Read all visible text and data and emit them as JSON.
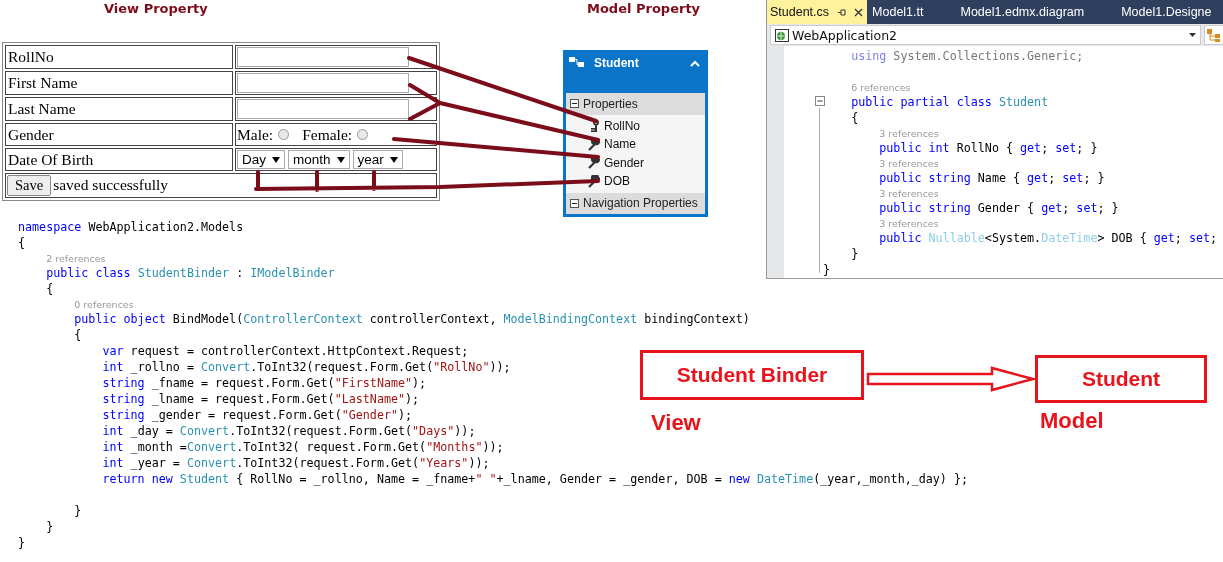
{
  "headings": [
    {
      "text": "View Property"
    },
    {
      "text": "Model Property"
    }
  ],
  "form": {
    "rows": [
      {
        "kind": "text",
        "label": "RollNo"
      },
      {
        "kind": "text",
        "label": "First Name"
      },
      {
        "kind": "text",
        "label": "Last Name"
      },
      {
        "kind": "radio",
        "label": "Gender",
        "options": [
          {
            "label": "Male:",
            "selected": false
          },
          {
            "label": "Female:",
            "selected": false
          }
        ]
      },
      {
        "kind": "selects",
        "label": "Date Of Birth",
        "selects": [
          "Day",
          "month",
          "year"
        ]
      }
    ],
    "save_button": "Save",
    "message": "saved successfully"
  },
  "entity": {
    "title": "Student",
    "sections": [
      {
        "label": "Properties",
        "items": [
          {
            "label": "RollNo",
            "kind": "key"
          },
          {
            "label": "Name",
            "kind": "property"
          },
          {
            "label": "Gender",
            "kind": "property"
          },
          {
            "label": "DOB",
            "kind": "property"
          }
        ]
      },
      {
        "label": "Navigation Properties"
      }
    ]
  },
  "editor": {
    "tabs": [
      {
        "label": "Student.cs",
        "selected": true
      },
      {
        "label": "Model1.tt",
        "selected": false
      },
      {
        "label": "Model1.edmx.diagram",
        "selected": false
      },
      {
        "label": "Model1.Designe",
        "selected": false
      }
    ],
    "project": "WebApplication2",
    "lines": [
      {
        "kind": "block",
        "children": [
          {
            "kind": "code",
            "tokens": [
              {
                "kind": "kw-dim",
                "text": "using"
              },
              {
                "kind": "plain-dim",
                "text": " System.Collections.Generic;"
              }
            ]
          },
          {
            "kind": "blank"
          },
          {
            "kind": "ref",
            "text": "6 references"
          },
          {
            "kind": "code",
            "tokens": [
              {
                "kind": "kw",
                "text": "public partial class"
              },
              {
                "kind": "type",
                "text": " Student"
              }
            ]
          },
          {
            "kind": "code",
            "tokens": [
              {
                "kind": "plain",
                "text": "{"
              }
            ],
            "children": [
              {
                "kind": "ref",
                "text": "3 references"
              },
              {
                "kind": "code",
                "tokens": [
                  {
                    "kind": "kw",
                    "text": "public int"
                  },
                  {
                    "kind": "plain",
                    "text": " RollNo { "
                  },
                  {
                    "kind": "kw",
                    "text": "get"
                  },
                  {
                    "kind": "plain",
                    "text": "; "
                  },
                  {
                    "kind": "kw",
                    "text": "set"
                  },
                  {
                    "kind": "plain",
                    "text": "; }"
                  }
                ]
              },
              {
                "kind": "ref",
                "text": "3 references"
              },
              {
                "kind": "code",
                "tokens": [
                  {
                    "kind": "kw",
                    "text": "public string"
                  },
                  {
                    "kind": "plain",
                    "text": " Name { "
                  },
                  {
                    "kind": "kw",
                    "text": "get"
                  },
                  {
                    "kind": "plain",
                    "text": "; "
                  },
                  {
                    "kind": "kw",
                    "text": "set"
                  },
                  {
                    "kind": "plain",
                    "text": "; }"
                  }
                ]
              },
              {
                "kind": "ref",
                "text": "3 references"
              },
              {
                "kind": "code",
                "tokens": [
                  {
                    "kind": "kw",
                    "text": "public string"
                  },
                  {
                    "kind": "plain",
                    "text": " Gender { "
                  },
                  {
                    "kind": "kw",
                    "text": "get"
                  },
                  {
                    "kind": "plain",
                    "text": "; "
                  },
                  {
                    "kind": "kw",
                    "text": "set"
                  },
                  {
                    "kind": "plain",
                    "text": "; }"
                  }
                ]
              },
              {
                "kind": "ref",
                "text": "3 references"
              },
              {
                "kind": "code",
                "tokens": [
                  {
                    "kind": "kw",
                    "text": "public "
                  },
                  {
                    "kind": "type-dim",
                    "text": "Nullable"
                  },
                  {
                    "kind": "plain",
                    "text": "<System."
                  },
                  {
                    "kind": "type-dim",
                    "text": "DateTime"
                  },
                  {
                    "kind": "plain",
                    "text": "> DOB { "
                  },
                  {
                    "kind": "kw",
                    "text": "get"
                  },
                  {
                    "kind": "plain",
                    "text": "; "
                  },
                  {
                    "kind": "kw",
                    "text": "set"
                  },
                  {
                    "kind": "plain",
                    "text": ";"
                  }
                ]
              }
            ]
          },
          {
            "kind": "code",
            "tokens": [
              {
                "kind": "plain",
                "text": "}"
              }
            ]
          }
        ]
      },
      {
        "kind": "code",
        "tokens": [
          {
            "kind": "plain",
            "text": "}"
          }
        ]
      }
    ]
  },
  "binder_code": {
    "lines": [
      {
        "kind": "code",
        "tokens": [
          {
            "kind": "kw",
            "text": "namespace"
          },
          {
            "kind": "plain",
            "text": " WebApplication2.Models"
          }
        ]
      },
      {
        "kind": "code",
        "tokens": [
          {
            "kind": "plain",
            "text": "{"
          }
        ],
        "children": [
          {
            "kind": "ref",
            "text": "2 references"
          },
          {
            "kind": "code",
            "tokens": [
              {
                "kind": "kw",
                "text": "public class"
              },
              {
                "kind": "type",
                "text": " StudentBinder"
              },
              {
                "kind": "plain",
                "text": " : "
              },
              {
                "kind": "type",
                "text": "IModelBinder"
              }
            ]
          },
          {
            "kind": "code",
            "tokens": [
              {
                "kind": "plain",
                "text": "{"
              }
            ],
            "children": [
              {
                "kind": "ref",
                "text": "0 references"
              },
              {
                "kind": "code",
                "tokens": [
                  {
                    "kind": "kw",
                    "text": "public object"
                  },
                  {
                    "kind": "plain",
                    "text": " BindModel("
                  },
                  {
                    "kind": "type",
                    "text": "ControllerContext"
                  },
                  {
                    "kind": "plain",
                    "text": " controllerContext, "
                  },
                  {
                    "kind": "type",
                    "text": "ModelBindingContext"
                  },
                  {
                    "kind": "plain",
                    "text": " bindingContext)"
                  }
                ]
              },
              {
                "kind": "code",
                "tokens": [
                  {
                    "kind": "plain",
                    "text": "{"
                  }
                ],
                "children": [
                  {
                    "kind": "code",
                    "tokens": [
                      {
                        "kind": "kw",
                        "text": "var"
                      },
                      {
                        "kind": "plain",
                        "text": " request = controllerContext.HttpContext.Request;"
                      }
                    ]
                  },
                  {
                    "kind": "code",
                    "tokens": [
                      {
                        "kind": "kw",
                        "text": "int"
                      },
                      {
                        "kind": "plain",
                        "text": " _rollno = "
                      },
                      {
                        "kind": "type",
                        "text": "Convert"
                      },
                      {
                        "kind": "plain",
                        "text": ".ToInt32(request.Form.Get("
                      },
                      {
                        "kind": "str",
                        "text": "\"RollNo\""
                      },
                      {
                        "kind": "plain",
                        "text": "));"
                      }
                    ]
                  },
                  {
                    "kind": "code",
                    "tokens": [
                      {
                        "kind": "kw",
                        "text": "string"
                      },
                      {
                        "kind": "plain",
                        "text": " _fname = request.Form.Get("
                      },
                      {
                        "kind": "str",
                        "text": "\"FirstName\""
                      },
                      {
                        "kind": "plain",
                        "text": ");"
                      }
                    ]
                  },
                  {
                    "kind": "code",
                    "tokens": [
                      {
                        "kind": "kw",
                        "text": "string"
                      },
                      {
                        "kind": "plain",
                        "text": " _lname = request.Form.Get("
                      },
                      {
                        "kind": "str",
                        "text": "\"LastName\""
                      },
                      {
                        "kind": "plain",
                        "text": ");"
                      }
                    ]
                  },
                  {
                    "kind": "code",
                    "tokens": [
                      {
                        "kind": "kw",
                        "text": "string"
                      },
                      {
                        "kind": "plain",
                        "text": " _gender = request.Form.Get("
                      },
                      {
                        "kind": "str",
                        "text": "\"Gender\""
                      },
                      {
                        "kind": "plain",
                        "text": ");"
                      }
                    ]
                  },
                  {
                    "kind": "code",
                    "tokens": [
                      {
                        "kind": "kw",
                        "text": "int"
                      },
                      {
                        "kind": "plain",
                        "text": " _day = "
                      },
                      {
                        "kind": "type",
                        "text": "Convert"
                      },
                      {
                        "kind": "plain",
                        "text": ".ToInt32(request.Form.Get("
                      },
                      {
                        "kind": "str",
                        "text": "\"Days\""
                      },
                      {
                        "kind": "plain",
                        "text": "));"
                      }
                    ]
                  },
                  {
                    "kind": "code",
                    "tokens": [
                      {
                        "kind": "kw",
                        "text": "int"
                      },
                      {
                        "kind": "plain",
                        "text": " _month ="
                      },
                      {
                        "kind": "type",
                        "text": "Convert"
                      },
                      {
                        "kind": "plain",
                        "text": ".ToInt32( request.Form.Get("
                      },
                      {
                        "kind": "str",
                        "text": "\"Months\""
                      },
                      {
                        "kind": "plain",
                        "text": "));"
                      }
                    ]
                  },
                  {
                    "kind": "code",
                    "tokens": [
                      {
                        "kind": "kw",
                        "text": "int"
                      },
                      {
                        "kind": "plain",
                        "text": " _year = "
                      },
                      {
                        "kind": "type",
                        "text": "Convert"
                      },
                      {
                        "kind": "plain",
                        "text": ".ToInt32(request.Form.Get("
                      },
                      {
                        "kind": "str",
                        "text": "\"Years\""
                      },
                      {
                        "kind": "plain",
                        "text": "));"
                      }
                    ]
                  },
                  {
                    "kind": "code",
                    "tokens": [
                      {
                        "kind": "kw",
                        "text": "return new"
                      },
                      {
                        "kind": "type",
                        "text": " Student"
                      },
                      {
                        "kind": "plain",
                        "text": " { RollNo = _rollno, Name = _fname+"
                      },
                      {
                        "kind": "str",
                        "text": "\" \""
                      },
                      {
                        "kind": "plain",
                        "text": "+_lname, Gender = _gender, DOB = "
                      },
                      {
                        "kind": "kw",
                        "text": "new"
                      },
                      {
                        "kind": "type",
                        "text": " DateTime"
                      },
                      {
                        "kind": "plain",
                        "text": "(_year,_month,_day) };"
                      }
                    ]
                  },
                  {
                    "kind": "blank"
                  }
                ]
              },
              {
                "kind": "code",
                "tokens": [
                  {
                    "kind": "plain",
                    "text": "}"
                  }
                ]
              }
            ]
          },
          {
            "kind": "code",
            "tokens": [
              {
                "kind": "plain",
                "text": "}"
              }
            ]
          }
        ]
      },
      {
        "kind": "code",
        "tokens": [
          {
            "kind": "plain",
            "text": "}"
          }
        ]
      }
    ]
  },
  "diagram": {
    "boxes": [
      {
        "text": "Student Binder"
      },
      {
        "text": "Student"
      }
    ],
    "captions": [
      {
        "text": "View"
      },
      {
        "text": "Model"
      }
    ]
  }
}
